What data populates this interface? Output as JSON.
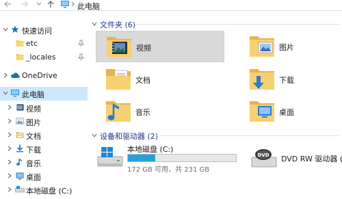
{
  "address": {
    "path_label": "此电脑"
  },
  "nav": {
    "items": [
      {
        "label": "快速访问",
        "icon": "star-icon",
        "expandable": true,
        "indent": 0,
        "pinned": false,
        "selected": false
      },
      {
        "label": "etc",
        "icon": "folder-icon",
        "expandable": false,
        "indent": 1,
        "pinned": true,
        "selected": false
      },
      {
        "label": "_locales",
        "icon": "folder-icon",
        "expandable": false,
        "indent": 1,
        "pinned": true,
        "selected": false
      },
      {
        "label": "OneDrive",
        "icon": "onedrive-icon",
        "expandable": true,
        "indent": 0,
        "pinned": false,
        "selected": false
      },
      {
        "label": "此电脑",
        "icon": "computer-icon",
        "expandable": true,
        "indent": 0,
        "pinned": false,
        "selected": true
      },
      {
        "label": "视频",
        "icon": "videos-icon",
        "expandable": true,
        "indent": 1,
        "pinned": false,
        "selected": false
      },
      {
        "label": "图片",
        "icon": "pictures-icon",
        "expandable": true,
        "indent": 1,
        "pinned": false,
        "selected": false
      },
      {
        "label": "文档",
        "icon": "documents-icon",
        "expandable": true,
        "indent": 1,
        "pinned": false,
        "selected": false
      },
      {
        "label": "下载",
        "icon": "downloads-icon",
        "expandable": true,
        "indent": 1,
        "pinned": false,
        "selected": false
      },
      {
        "label": "音乐",
        "icon": "music-icon",
        "expandable": true,
        "indent": 1,
        "pinned": false,
        "selected": false
      },
      {
        "label": "桌面",
        "icon": "desktop-icon",
        "expandable": true,
        "indent": 1,
        "pinned": false,
        "selected": false
      },
      {
        "label": "本地磁盘 (C:)",
        "icon": "hard-drive-icon",
        "expandable": true,
        "indent": 1,
        "pinned": false,
        "selected": false
      }
    ]
  },
  "folders_group": {
    "title": "文件夹 (6)",
    "items": [
      {
        "label": "视频",
        "icon": "videos-folder-icon",
        "selected": true
      },
      {
        "label": "图片",
        "icon": "pictures-folder-icon",
        "selected": false
      },
      {
        "label": "文档",
        "icon": "documents-folder-icon",
        "selected": false
      },
      {
        "label": "下载",
        "icon": "downloads-folder-icon",
        "selected": false
      },
      {
        "label": "音乐",
        "icon": "music-folder-icon",
        "selected": false
      },
      {
        "label": "桌面",
        "icon": "desktop-folder-icon",
        "selected": false
      }
    ]
  },
  "devices_group": {
    "title": "设备和驱动器 (2)",
    "drives": [
      {
        "label": "本地磁盘 (C:)",
        "icon": "hard-drive-icon",
        "used_fraction": 0.255,
        "space_text": "172 GB 可用，共 231 GB"
      },
      {
        "label": "DVD RW 驱动器 (E:)",
        "icon": "dvd-drive-icon"
      }
    ]
  },
  "colors": {
    "selection_blue": "#cce8ff",
    "tile_selected": "#d9d9d9",
    "usage_bar": "#26a0da",
    "group_title": "#1e3287"
  }
}
